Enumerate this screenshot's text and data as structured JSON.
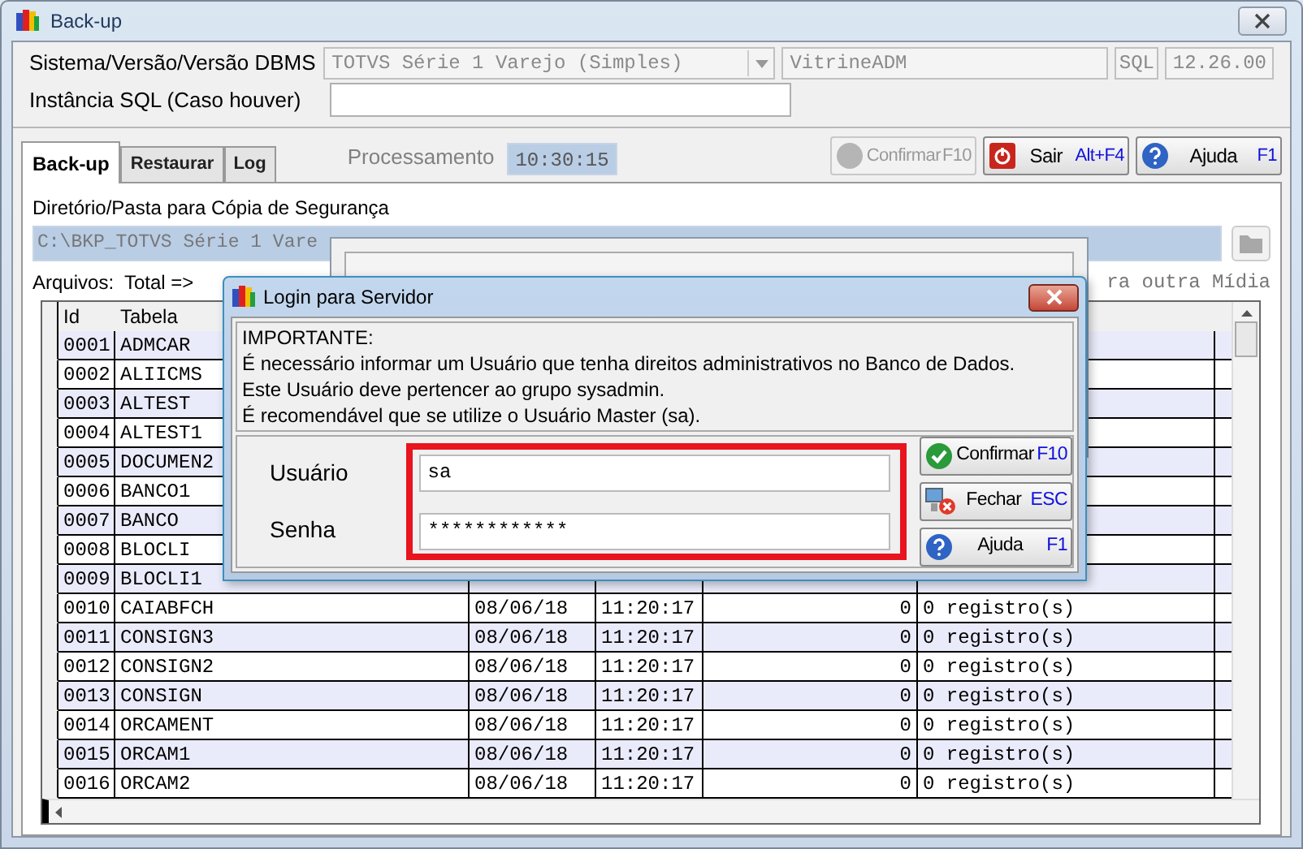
{
  "window": {
    "title": "Back-up"
  },
  "header": {
    "system_label": "Sistema/Versão/Versão DBMS",
    "system_value": "TOTVS Série 1 Varejo (Simples)",
    "database": "VitrineADM",
    "dbms": "SQL",
    "version": "12.26.00",
    "instance_label": "Instância SQL (Caso houver)"
  },
  "tabs": [
    {
      "label": "Back-up",
      "selected": true
    },
    {
      "label": "Restaurar",
      "selected": false
    },
    {
      "label": "Log",
      "selected": false
    }
  ],
  "processing": {
    "label": "Processamento",
    "time": "10:30:15"
  },
  "toolbar": [
    {
      "kind": "confirm",
      "label": "Confirmar",
      "shortcut": "F10",
      "disabled": true
    },
    {
      "kind": "exit",
      "label": "Sair",
      "shortcut": "Alt+F4",
      "disabled": false
    },
    {
      "kind": "help",
      "label": "Ajuda",
      "shortcut": "F1",
      "disabled": false
    }
  ],
  "folder": {
    "label": "Diretório/Pasta para Cópia de Segurança",
    "path": "C:\\BKP_TOTVS Série 1 Vare"
  },
  "files": {
    "label": "Arquivos:  Total =>",
    "trailing": "ra outra Mídia"
  },
  "table": {
    "columns": [
      "Id",
      "Tabela"
    ],
    "rows": [
      {
        "id": "0001",
        "table": "ADMCAR"
      },
      {
        "id": "0002",
        "table": "ALIICMS"
      },
      {
        "id": "0003",
        "table": "ALTEST"
      },
      {
        "id": "0004",
        "table": "ALTEST1"
      },
      {
        "id": "0005",
        "table": "DOCUMEN2"
      },
      {
        "id": "0006",
        "table": "BANCO1"
      },
      {
        "id": "0007",
        "table": "BANCO"
      },
      {
        "id": "0008",
        "table": "BLOCLI"
      },
      {
        "id": "0009",
        "table": "BLOCLI1"
      },
      {
        "id": "0010",
        "table": "CAIABFCH",
        "date": "08/06/18",
        "time": "11:20:17",
        "count": "0",
        "records": "0 registro(s)"
      },
      {
        "id": "0011",
        "table": "CONSIGN3",
        "date": "08/06/18",
        "time": "11:20:17",
        "count": "0",
        "records": "0 registro(s)"
      },
      {
        "id": "0012",
        "table": "CONSIGN2",
        "date": "08/06/18",
        "time": "11:20:17",
        "count": "0",
        "records": "0 registro(s)"
      },
      {
        "id": "0013",
        "table": "CONSIGN",
        "date": "08/06/18",
        "time": "11:20:17",
        "count": "0",
        "records": "0 registro(s)"
      },
      {
        "id": "0014",
        "table": "ORCAMENT",
        "date": "08/06/18",
        "time": "11:20:17",
        "count": "0",
        "records": "0 registro(s)"
      },
      {
        "id": "0015",
        "table": "ORCAM1",
        "date": "08/06/18",
        "time": "11:20:17",
        "count": "0",
        "records": "0 registro(s)"
      },
      {
        "id": "0016",
        "table": "ORCAM2",
        "date": "08/06/18",
        "time": "11:20:17",
        "count": "0",
        "records": "0 registro(s)"
      }
    ]
  },
  "login_dialog": {
    "title": "Login para Servidor",
    "notice": [
      "IMPORTANTE:",
      "É necessário informar um Usuário que tenha direitos administrativos no Banco de Dados.",
      "Este Usuário deve pertencer ao grupo sysadmin.",
      "É recomendável que se utilize o Usuário Master (sa)."
    ],
    "fields": [
      {
        "label": "Usuário",
        "value": "sa"
      },
      {
        "label": "Senha",
        "value": "************"
      }
    ],
    "buttons": [
      {
        "kind": "confirm",
        "label": "Confirmar",
        "shortcut": "F10"
      },
      {
        "kind": "close",
        "label": "Fechar",
        "shortcut": "ESC"
      },
      {
        "kind": "help",
        "label": "Ajuda",
        "shortcut": "F1"
      }
    ]
  }
}
